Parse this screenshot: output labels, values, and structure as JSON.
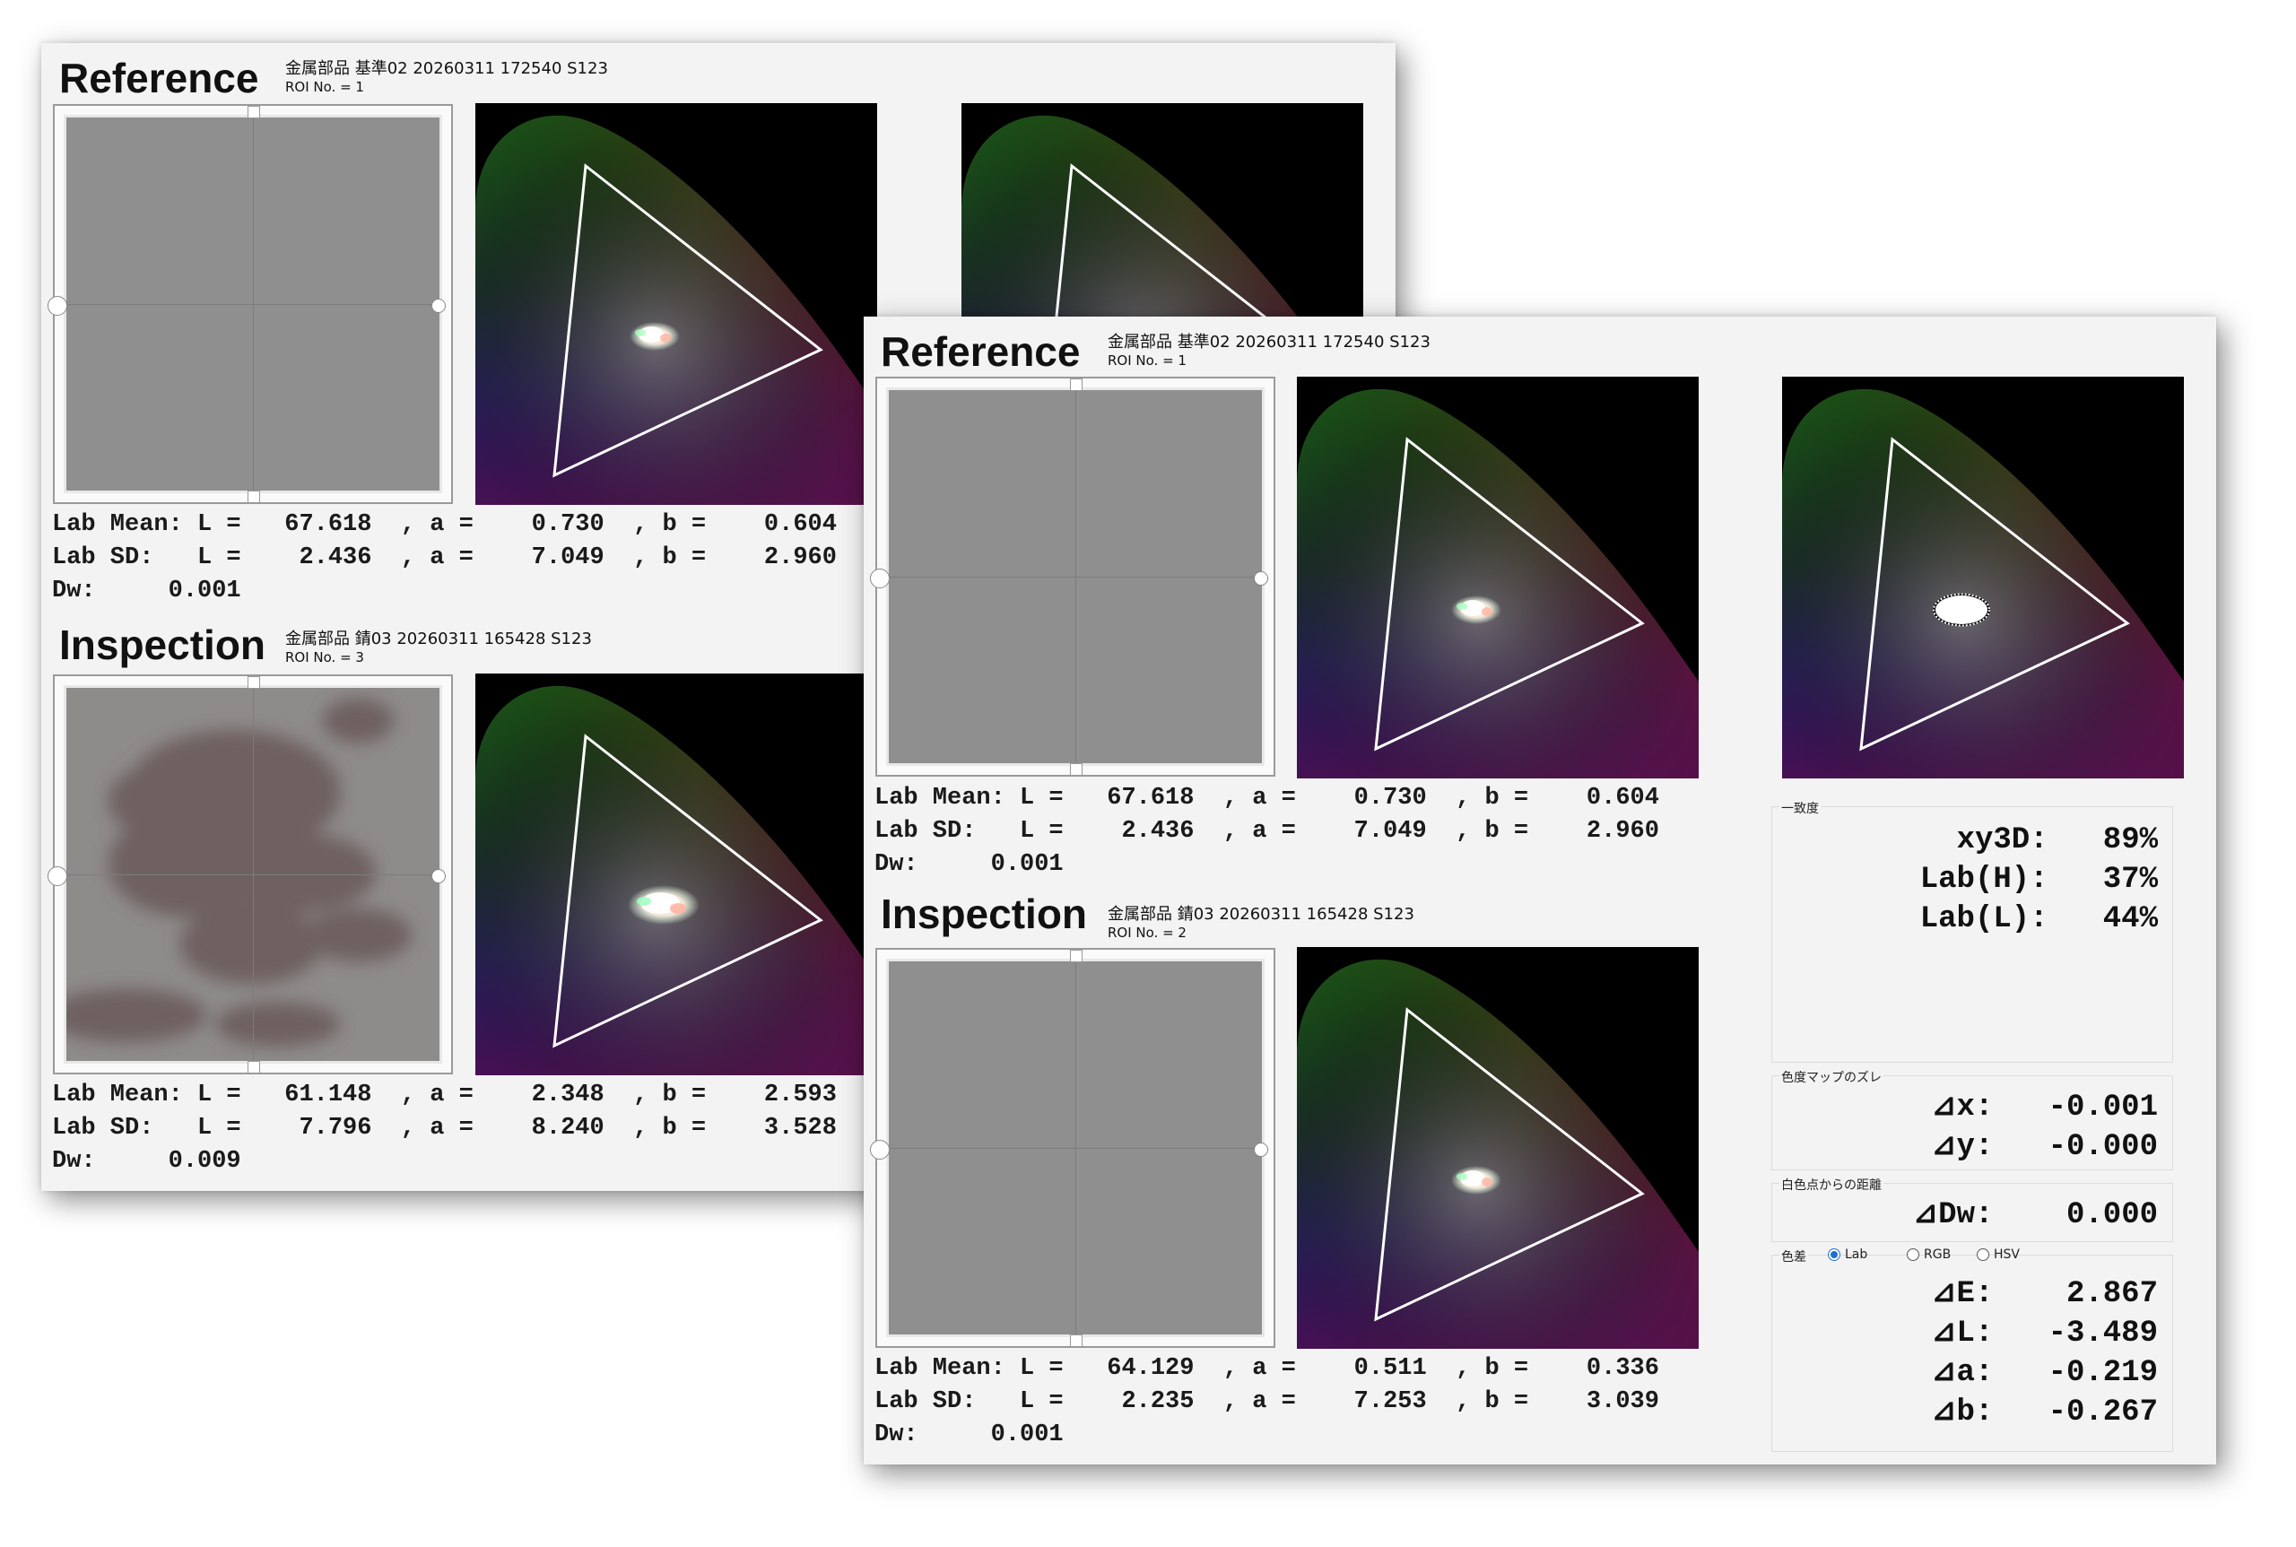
{
  "back_window": {
    "reference": {
      "title": "Reference",
      "meta": "金属部品  基準02  20260311  172540  S123",
      "roi": "ROI No. = 1",
      "stats": [
        "Lab Mean: L =   67.618  , a =    0.730  , b =    0.604",
        "Lab SD:   L =    2.436  , a =    7.049  , b =    2.960",
        "Dw:     0.001"
      ]
    },
    "inspection": {
      "title": "Inspection",
      "meta": "金属部品  錆03  20260311  165428  S123",
      "roi": "ROI No. = 3",
      "stats": [
        "Lab Mean: L =   61.148  , a =    2.348  , b =    2.593",
        "Lab SD:   L =    7.796  , a =    8.240  , b =    3.528",
        "Dw:     0.009"
      ]
    }
  },
  "front_window": {
    "reference": {
      "title": "Reference",
      "meta": "金属部品  基準02  20260311  172540  S123",
      "roi": "ROI No. = 1",
      "stats": [
        "Lab Mean: L =   67.618  , a =    0.730  , b =    0.604",
        "Lab SD:   L =    2.436  , a =    7.049  , b =    2.960",
        "Dw:     0.001"
      ]
    },
    "inspection": {
      "title": "Inspection",
      "meta": "金属部品  錆03  20260311  165428  S123",
      "roi": "ROI No. = 2",
      "stats": [
        "Lab Mean: L =   64.129  , a =    0.511  , b =    0.336",
        "Lab SD:   L =    2.235  , a =    7.253  , b =    3.039",
        "Dw:     0.001"
      ]
    },
    "match_panel": {
      "label": "一致度",
      "rows": [
        "xy3D:   89%",
        "Lab(H):   37%",
        "Lab(L):   44%"
      ]
    },
    "chroma_shift_panel": {
      "label": "色度マップのズレ",
      "rows": [
        "⊿x:   -0.001",
        "⊿y:   -0.000"
      ]
    },
    "white_distance_panel": {
      "label": "白色点からの距離",
      "rows": [
        "⊿Dw:    0.000"
      ]
    },
    "color_diff_panel": {
      "label": "色差",
      "options": [
        "Lab",
        "RGB",
        "HSV"
      ],
      "selected": "Lab",
      "rows": [
        "⊿E:    2.867",
        "⊿L:   -3.489",
        "⊿a:   -0.219",
        "⊿b:   -0.267"
      ]
    }
  }
}
